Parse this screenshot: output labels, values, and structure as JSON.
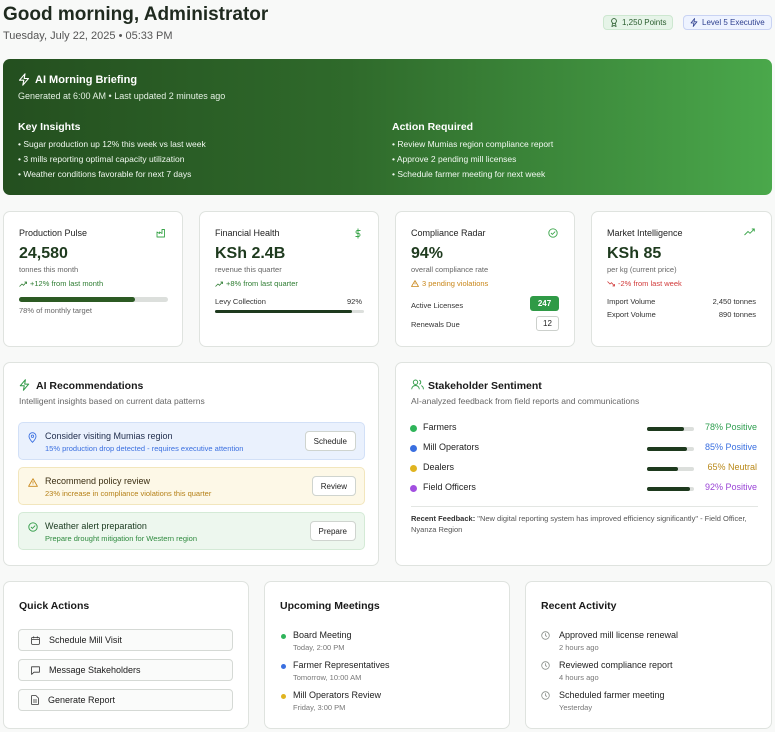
{
  "header": {
    "greeting": "Good morning, Administrator",
    "datetime": "Tuesday, July 22, 2025 • 05:33 PM",
    "points": "1,250 Points",
    "level": "Level 5 Executive"
  },
  "briefing": {
    "title": "AI Morning Briefing",
    "subtitle": "Generated at 6:00 AM • Last updated 2 minutes ago",
    "insights_title": "Key Insights",
    "insights": [
      "• Sugar production up 12% this week vs last week",
      "• 3 mills reporting optimal capacity utilization",
      "• Weather conditions favorable for next 7 days"
    ],
    "actions_title": "Action Required",
    "actions": [
      "• Review Mumias region compliance report",
      "• Approve 2 pending mill licenses",
      "• Schedule farmer meeting for next week"
    ]
  },
  "stats": {
    "production": {
      "title": "Production Pulse",
      "value": "24,580",
      "caption": "tonnes this month",
      "trend": "+12% from last month",
      "target_progress": 0.78,
      "target_label": "78% of monthly target"
    },
    "financial": {
      "title": "Financial Health",
      "value": "KSh 2.4B",
      "caption": "revenue this quarter",
      "trend": "+8% from last quarter",
      "levy_label": "Levy Collection",
      "levy_pct": "92%",
      "levy_progress": 0.92
    },
    "compliance": {
      "title": "Compliance Radar",
      "value": "94%",
      "caption": "overall compliance rate",
      "warning": "3 pending violations",
      "active_label": "Active Licenses",
      "active_value": "247",
      "renewals_label": "Renewals Due",
      "renewals_value": "12"
    },
    "market": {
      "title": "Market Intelligence",
      "value": "KSh 85",
      "caption": "per kg (current price)",
      "trend": "-2% from last week",
      "import_label": "Import Volume",
      "import_value": "2,450 tonnes",
      "export_label": "Export Volume",
      "export_value": "890 tonnes"
    }
  },
  "recommendations": {
    "title": "AI Recommendations",
    "subtitle": "Intelligent insights based on current data patterns",
    "items": [
      {
        "title": "Consider visiting Mumias region",
        "desc": "15% production drop detected - requires executive attention",
        "button": "Schedule"
      },
      {
        "title": "Recommend policy review",
        "desc": "23% increase in compliance violations this quarter",
        "button": "Review"
      },
      {
        "title": "Weather alert preparation",
        "desc": "Prepare drought mitigation for Western region",
        "button": "Prepare"
      }
    ]
  },
  "sentiment": {
    "title": "Stakeholder Sentiment",
    "subtitle": "AI-analyzed feedback from field reports and communications",
    "items": [
      {
        "name": "Farmers",
        "value": "78% Positive",
        "level": 0.78,
        "color": "#2fb45a",
        "text_color": "#2e9e4f"
      },
      {
        "name": "Mill Operators",
        "value": "85% Positive",
        "level": 0.85,
        "color": "#3a6fe0",
        "text_color": "#3a6fe0"
      },
      {
        "name": "Dealers",
        "value": "65% Neutral",
        "level": 0.65,
        "color": "#e0b420",
        "text_color": "#b9891a"
      },
      {
        "name": "Field Officers",
        "value": "92% Positive",
        "level": 0.92,
        "color": "#a24fe0",
        "text_color": "#9a44d6"
      }
    ],
    "feedback_label": "Recent Feedback:",
    "feedback_text": "\"New digital reporting system has improved efficiency significantly\" - Field Officer, Nyanza Region"
  },
  "quick_actions": {
    "title": "Quick Actions",
    "items": [
      "Schedule Mill Visit",
      "Message Stakeholders",
      "Generate Report"
    ]
  },
  "meetings": {
    "title": "Upcoming Meetings",
    "items": [
      {
        "title": "Board Meeting",
        "time": "Today, 2:00 PM",
        "color": "#2fb45a"
      },
      {
        "title": "Farmer Representatives",
        "time": "Tomorrow, 10:00 AM",
        "color": "#3a6fe0"
      },
      {
        "title": "Mill Operators Review",
        "time": "Friday, 3:00 PM",
        "color": "#e0b420"
      }
    ]
  },
  "activity": {
    "title": "Recent Activity",
    "items": [
      {
        "title": "Approved mill license renewal",
        "time": "2 hours ago"
      },
      {
        "title": "Reviewed compliance report",
        "time": "4 hours ago"
      },
      {
        "title": "Scheduled farmer meeting",
        "time": "Yesterday"
      }
    ]
  }
}
